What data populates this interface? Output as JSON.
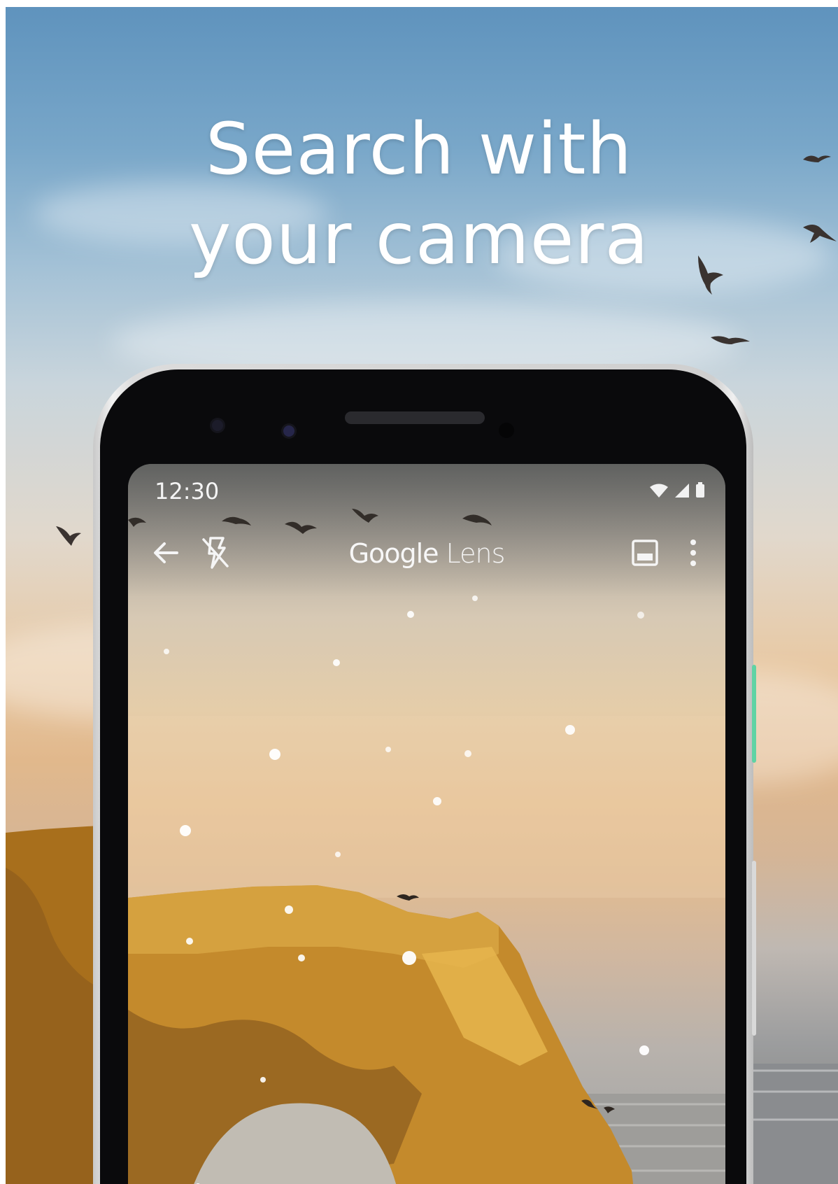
{
  "headline": {
    "line1": "Search with",
    "line2": "your camera"
  },
  "phone": {
    "status_bar": {
      "time": "12:30",
      "icons": [
        "wifi-icon",
        "signal-icon",
        "battery-icon"
      ]
    },
    "toolbar": {
      "back_icon": "arrow-back-icon",
      "flash_icon": "flash-off-icon",
      "title_brand": "Google",
      "title_product": "Lens",
      "gallery_icon": "image-gallery-icon",
      "more_icon": "more-vert-icon"
    }
  },
  "colors": {
    "sky_top": "#5f93bd",
    "sky_horizon": "#e8c9a4",
    "rock": "#c7902f",
    "phone_bezel": "#0a0a0c",
    "text": "#ffffff"
  }
}
